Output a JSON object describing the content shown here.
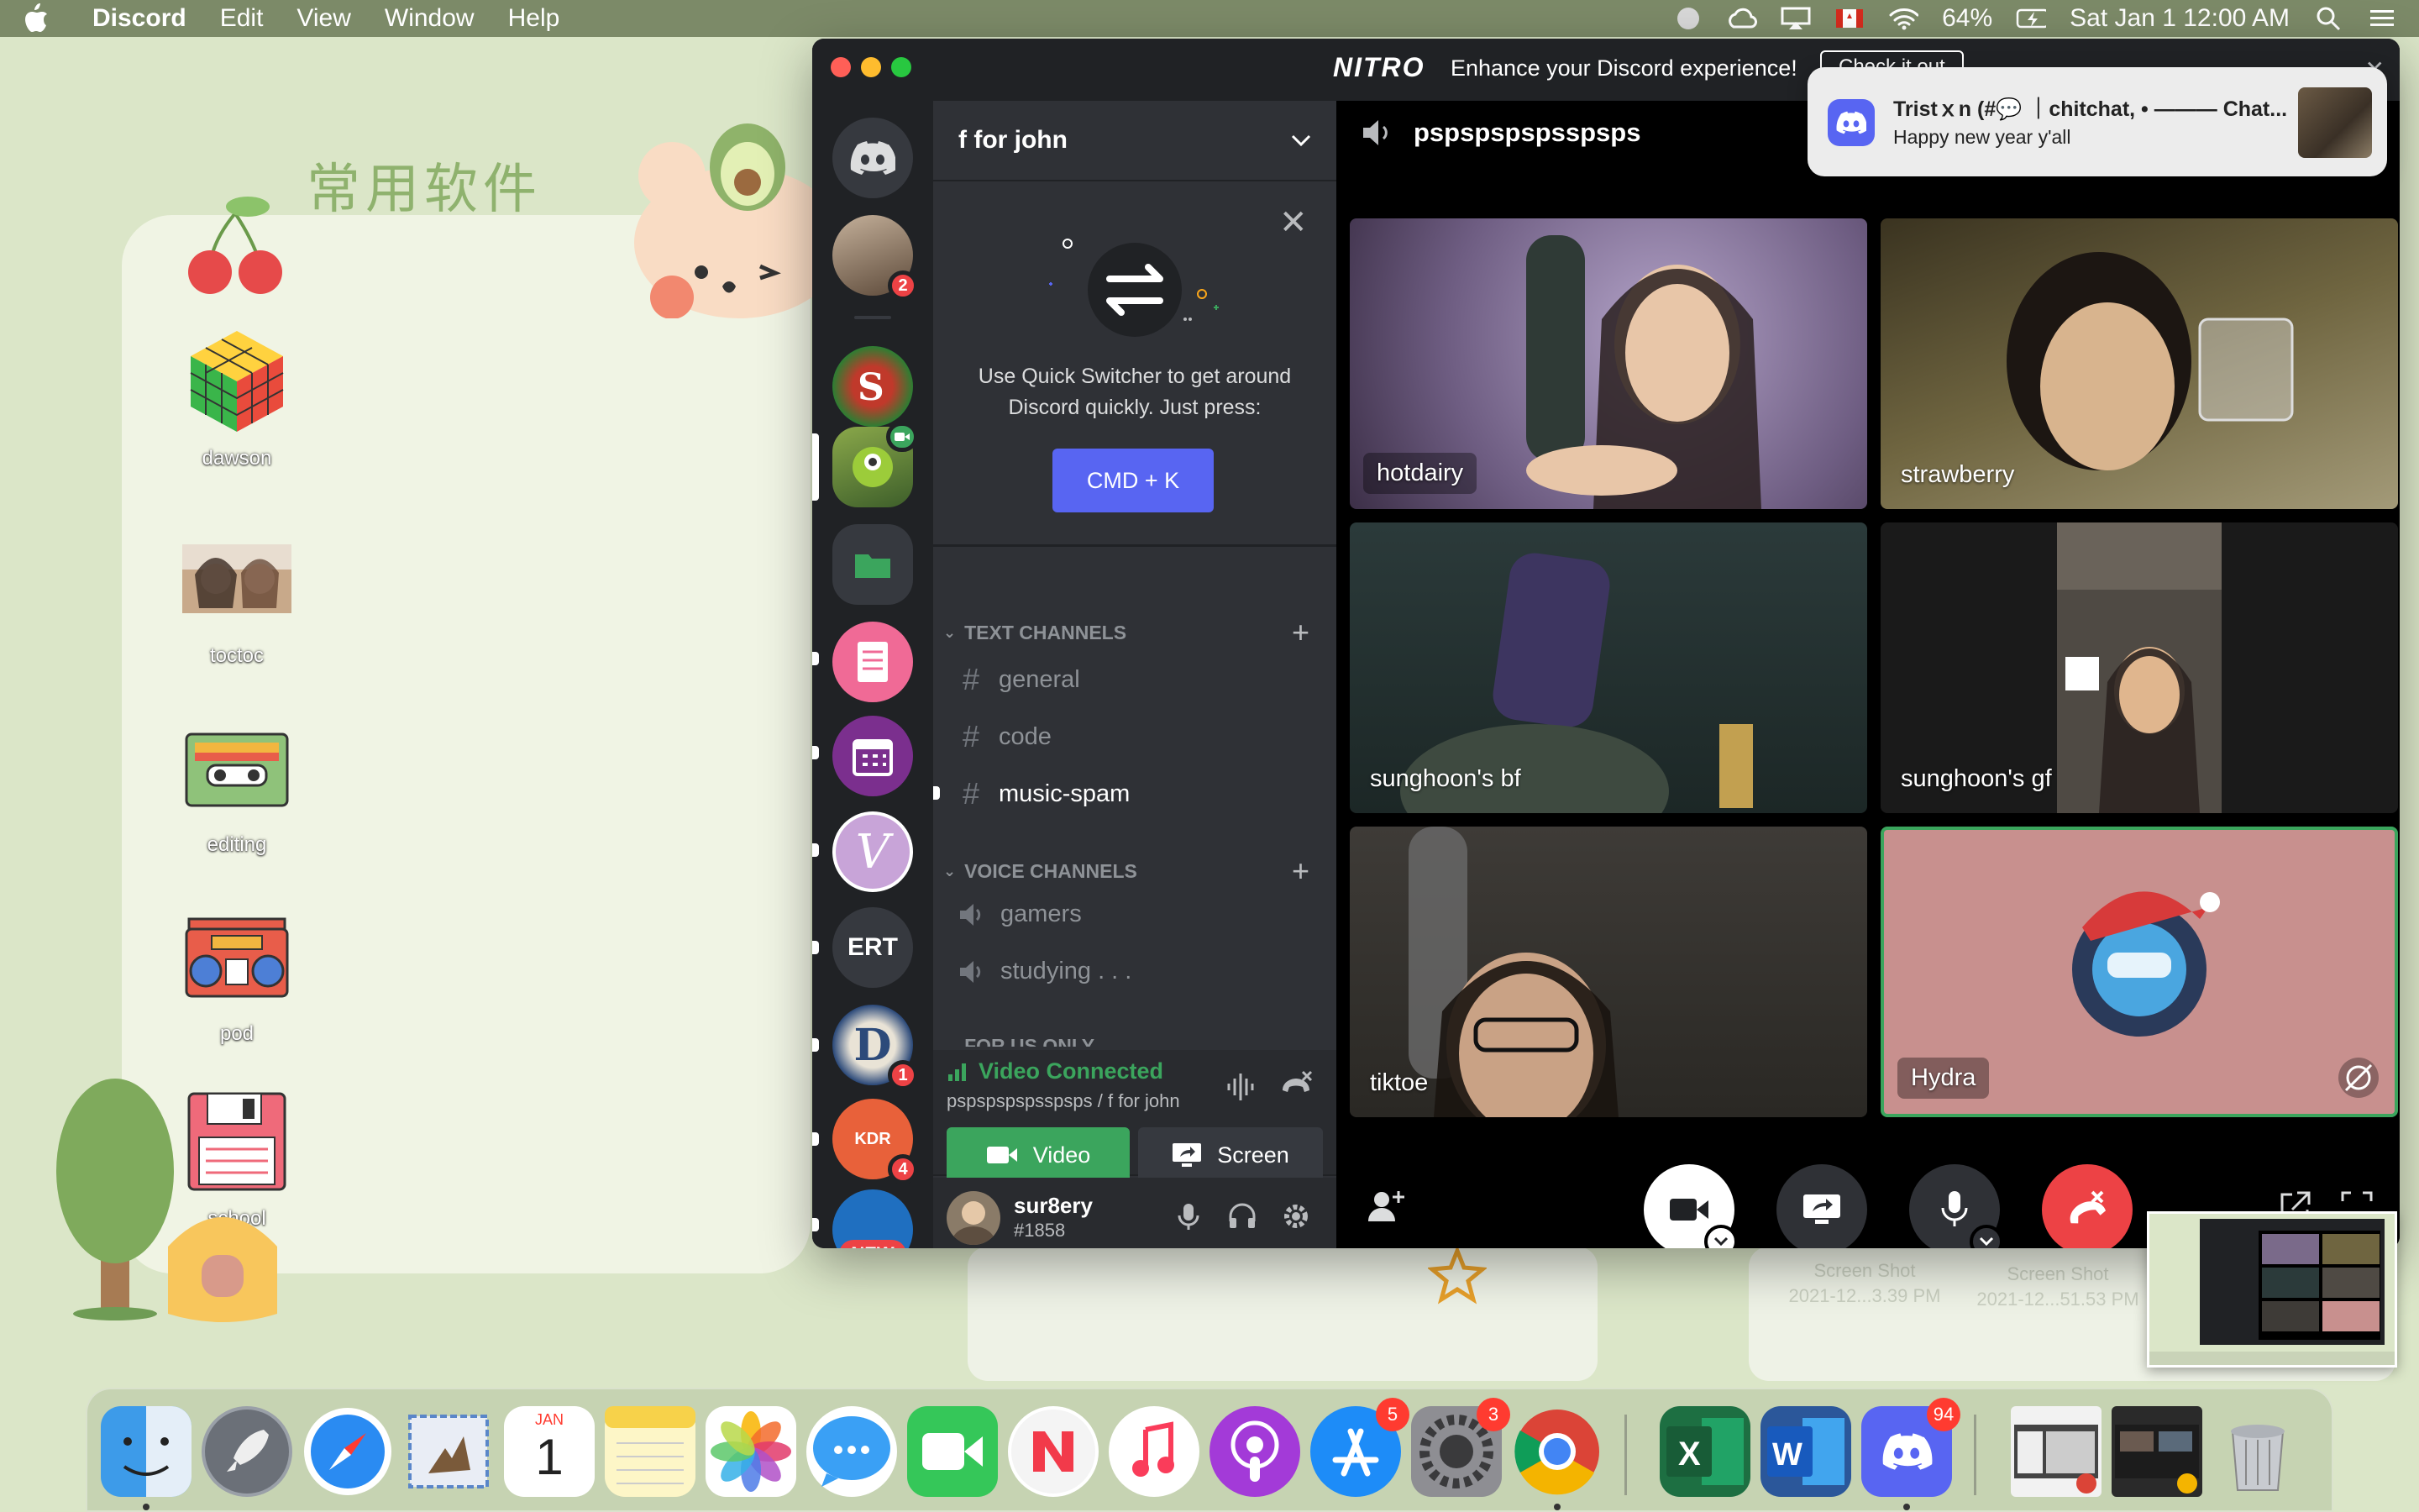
{
  "menubar": {
    "app_name": "Discord",
    "menus": [
      "Edit",
      "View",
      "Window",
      "Help"
    ],
    "battery": "64%",
    "datetime": "Sat Jan 1  12:00 AM"
  },
  "desktop": {
    "widget_title": "常用软件",
    "icons": [
      {
        "label": "dawson"
      },
      {
        "label": "toctoc"
      },
      {
        "label": "editing"
      },
      {
        "label": "pod"
      },
      {
        "label": "school"
      }
    ],
    "screenshots": [
      {
        "label": "Screen Shot\n2021-12...3.39 PM"
      },
      {
        "label": "Screen Shot\n2021-12...51.53 PM"
      }
    ]
  },
  "discord": {
    "nitro": {
      "logo": "NITRO",
      "text": "Enhance your Discord experience!",
      "button": "Check it out"
    },
    "server_name": "f for john",
    "guilds": [
      {
        "name": "profile-photo-server",
        "badge": "2"
      },
      {
        "name": "christmas-server",
        "badge": ""
      },
      {
        "name": "monster-server",
        "badge": ""
      },
      {
        "name": "folder",
        "badge": ""
      },
      {
        "name": "notebook-server",
        "badge": ""
      },
      {
        "name": "calendar-server",
        "badge": ""
      },
      {
        "name": "v-server",
        "label": "V",
        "badge": ""
      },
      {
        "name": "ert-server",
        "label": "ERT",
        "badge": ""
      },
      {
        "name": "d-server",
        "label": "D",
        "badge": "1"
      },
      {
        "name": "kdrama-server",
        "label": "KDR",
        "badge": "4"
      },
      {
        "name": "new-server",
        "label": "NEW",
        "badge": ""
      }
    ],
    "quick_switcher": {
      "text": "Use Quick Switcher to get around Discord quickly. Just press:",
      "button": "CMD + K"
    },
    "text_category": "TEXT CHANNELS",
    "text_channels": [
      {
        "name": "general",
        "unread": false
      },
      {
        "name": "code",
        "unread": false
      },
      {
        "name": "music-spam",
        "unread": true
      }
    ],
    "voice_category": "VOICE CHANNELS",
    "voice_channels": [
      {
        "name": "gamers"
      },
      {
        "name": "studying . . ."
      }
    ],
    "hidden_category": "FOR US ONLY",
    "voice_status": {
      "status": "Video Connected",
      "sub": "pspspspspsspsps / f for john",
      "video_button": "Video",
      "screen_button": "Screen"
    },
    "user": {
      "name": "sur8ery",
      "tag": "#1858"
    },
    "stage_channel": "pspspspspsspsps",
    "participants": [
      {
        "name": "hotdairy"
      },
      {
        "name": "strawberry"
      },
      {
        "name": "sunghoon's bf"
      },
      {
        "name": "sunghoon's gf"
      },
      {
        "name": "tiktoe"
      },
      {
        "name": "Hydra"
      }
    ]
  },
  "notification": {
    "title": "Tristｘn (#💬 ｜chitchat, • ——— Chat...",
    "body": "Happy new year y'all"
  },
  "dock": {
    "badges": {
      "app_store": "5",
      "system_prefs": "3",
      "discord": "94"
    },
    "calendar_month": "JAN",
    "calendar_day": "1"
  },
  "colors": {
    "discord_blurple": "#5865f2",
    "discord_green": "#3ba55d",
    "discord_red": "#ed4245",
    "desktop_green": "#dbe6c8"
  }
}
